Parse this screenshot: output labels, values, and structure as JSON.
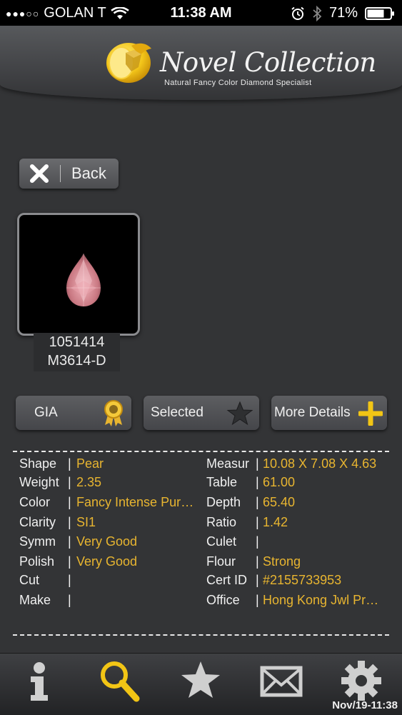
{
  "status_bar": {
    "signal": "●●●○○",
    "carrier": "GOLAN T",
    "time": "11:38 AM",
    "battery": "71%"
  },
  "header": {
    "title": "Novel Collection",
    "subtitle": "Natural Fancy Color Diamond Specialist"
  },
  "back_button": {
    "label": "Back"
  },
  "stone": {
    "id": "1051414",
    "code": "M3614-D"
  },
  "actions": {
    "gia": "GIA",
    "selected": "Selected",
    "more_details": "More Details"
  },
  "details": {
    "left": [
      {
        "label": "Shape",
        "value": "Pear"
      },
      {
        "label": "Weight",
        "value": "2.35"
      },
      {
        "label": "Color",
        "value": "Fancy Intense Pur…"
      },
      {
        "label": "Clarity",
        "value": "SI1"
      },
      {
        "label": "Symm",
        "value": "Very Good"
      },
      {
        "label": "Polish",
        "value": "Very Good"
      },
      {
        "label": "Cut",
        "value": ""
      },
      {
        "label": "Make",
        "value": ""
      }
    ],
    "right": [
      {
        "label": "Measur",
        "value": "10.08 X 7.08 X 4.63"
      },
      {
        "label": "Table",
        "value": "61.00"
      },
      {
        "label": "Depth",
        "value": "65.40"
      },
      {
        "label": "Ratio",
        "value": "1.42"
      },
      {
        "label": "Culet",
        "value": ""
      },
      {
        "label": "Flour",
        "value": "Strong"
      },
      {
        "label": "Cert ID",
        "value": "#2155733953"
      },
      {
        "label": "Office",
        "value": "Hong Kong Jwl Pr…"
      }
    ]
  },
  "tab_bar": {
    "tabs": [
      "info-icon",
      "search-icon",
      "star-icon",
      "mail-icon",
      "gear-icon"
    ],
    "active": "search-icon",
    "timestamp": "Nov/19-11:38"
  },
  "colors": {
    "accent": "#e8b530",
    "background": "#333436"
  }
}
